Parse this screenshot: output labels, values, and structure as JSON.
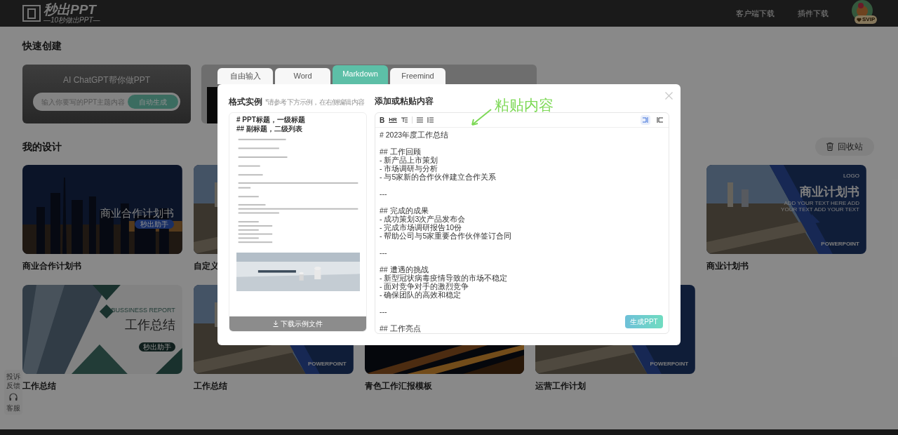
{
  "header": {
    "logo_title": "秒出PPT",
    "logo_subtitle": "—10秒做出PPT—",
    "links": [
      "客户端下载",
      "插件下载"
    ],
    "badge": "SVIP"
  },
  "quick_create": {
    "title": "快速创建",
    "ai_card": {
      "title": "AI ChatGPT帮你做PPT",
      "placeholder": "输入你要写的PPT主题内容",
      "button": "自动生成"
    }
  },
  "my_designs": {
    "title": "我的设计",
    "recycle_button": "回收站",
    "rows": [
      [
        {
          "title": "商业合作计划书",
          "slide_texts": [
            {
              "kind": "title",
              "text": "商业合作计划书"
            },
            {
              "kind": "pill",
              "text": "秒出助手"
            }
          ]
        },
        {
          "title": "自定义"
        },
        null,
        null,
        {
          "title": "商业计划书",
          "slide_texts": [
            {
              "kind": "logo",
              "text": "LOGO"
            },
            {
              "kind": "title",
              "text": "商业计划书"
            },
            {
              "kind": "subtitle",
              "text": "ADD YOUR TEXT HERE ADD YOUR TEXT ADD YOUR TEXT"
            },
            {
              "kind": "footer",
              "text": "POWERPOINT"
            }
          ]
        }
      ],
      [
        {
          "title": "工作总结",
          "slide_texts": [
            {
              "kind": "subtitle",
              "text": "BUSSINESS REPORT"
            },
            {
              "kind": "title",
              "text": "工作总结"
            },
            {
              "kind": "pill",
              "text": "秒出助手"
            }
          ]
        },
        {
          "title": "工作总结",
          "slide_texts": [
            {
              "kind": "footer",
              "text": "POWERPOINT"
            }
          ]
        },
        {
          "title": "青色工作汇报模板"
        },
        {
          "title": "运营工作计划",
          "slide_texts": [
            {
              "kind": "footer",
              "text": "POWERPOINT"
            }
          ]
        }
      ]
    ]
  },
  "feedback": {
    "complaint": "投诉反馈",
    "service": "客服"
  },
  "dialog": {
    "tabs": [
      {
        "label": "自由输入",
        "selected": false
      },
      {
        "label": "Word",
        "selected": false
      },
      {
        "label": "Markdown",
        "selected": true
      },
      {
        "label": "Freemind",
        "selected": false
      }
    ],
    "example": {
      "title": "格式实例",
      "note": "*请参考下方示例，在右侧编辑内容",
      "heading_1": "# PPT标题，一级标题",
      "heading_2": "## 副标题，二级列表",
      "download_button": "下载示例文件"
    },
    "editor": {
      "title": "添加或粘贴内容",
      "toolbar_labels": [
        "B",
        "HR"
      ],
      "view_modes": [
        {
          "selected": true
        },
        {
          "selected": false
        }
      ],
      "value": "# 2023年度工作总结\n\n## 工作回顾\n- 新产品上市策划\n- 市场调研与分析\n- 与5家新的合作伙伴建立合作关系\n\n---\n\n## 完成的成果\n- 成功策划3次产品发布会\n- 完成市场调研报告10份\n- 帮助公司与5家重要合作伙伴签订合同\n\n---\n\n## 遭遇的挑战\n- 新型冠状病毒疫情导致的市场不稳定\n- 面对竞争对手的激烈竞争\n- 确保团队的高效和稳定\n\n---\n\n## 工作亮点",
      "generate_button": "生成PPT"
    },
    "annotation": "粘贴内容"
  }
}
